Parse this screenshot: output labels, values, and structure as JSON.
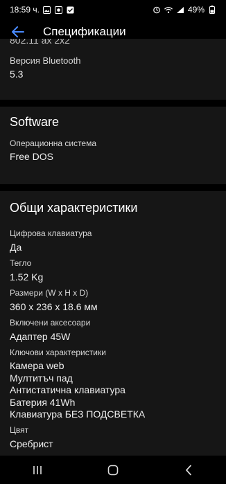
{
  "status_bar": {
    "time": "18:59 ч.",
    "battery": "49%"
  },
  "app_bar": {
    "title": "Спецификации"
  },
  "sections": {
    "bluetooth": {
      "cut_text": "802.11 ax 2x2",
      "label": "Версия Bluetooth",
      "value": "5.3"
    },
    "software": {
      "title": "Software",
      "os_label": "Операционна система",
      "os_value": "Free DOS"
    },
    "general": {
      "title": "Общи характеристики",
      "numpad_label": "Цифрова клавиатура",
      "numpad_value": "Да",
      "weight_label": "Тегло",
      "weight_value": "1.52 Kg",
      "dimensions_label": "Размери (W x H x D)",
      "dimensions_value": "360 x 236 x 18.6 мм",
      "accessories_label": "Включени аксесоари",
      "accessories_value": "Адаптер 45W",
      "features_label": "Ключови характеристики",
      "features_values": [
        "Камера web",
        "Мултитъч пад",
        "Антистатична клавиатура",
        "Батерия 41Wh",
        "Клавиатура БЕЗ ПОДСВЕТКА"
      ],
      "color_label": "Цвят",
      "color_value": "Сребрист"
    }
  },
  "colors": {
    "accent": "#4a8cff",
    "card_bg": "#161616"
  }
}
